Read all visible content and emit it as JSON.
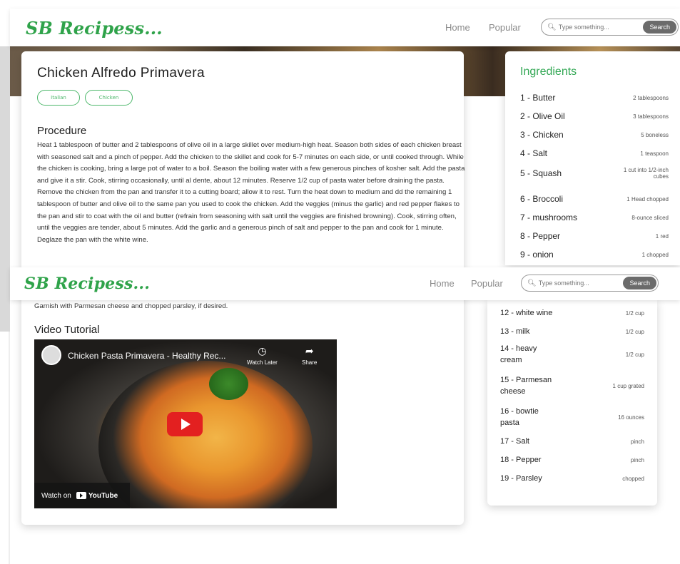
{
  "nav": {
    "logo": "SB Recipess...",
    "home": "Home",
    "popular": "Popular",
    "search_placeholder": "Type something...",
    "search_button": "Search"
  },
  "recipe": {
    "title": "Chicken Alfredo Primavera",
    "tags": [
      "Italian",
      "Chicken"
    ],
    "procedure_heading": "Procedure",
    "procedure_text": "Heat 1 tablespoon of butter and 2 tablespoons of olive oil in a large skillet over medium-high heat. Season both sides of each chicken breast with seasoned salt and a pinch of pepper. Add the chicken to the skillet and cook for 5-7 minutes on each side, or until cooked through. While the chicken is cooking, bring a large pot of water to a boil. Season the boiling water with a few generous pinches of kosher salt. Add the pasta and give it a stir. Cook, stirring occasionally, until al dente, about 12 minutes. Reserve 1/2 cup of pasta water before draining the pasta. Remove the chicken from the pan and transfer it to a cutting board; allow it to rest. Turn the heat down to medium and dd the remaining 1 tablespoon of butter and olive oil to the same pan you used to cook the chicken. Add the veggies (minus the garlic) and red pepper flakes to the pan and stir to coat with the oil and butter (refrain from seasoning with salt until the veggies are finished browning). Cook, stirring often, until the veggies are tender, about 5 minutes. Add the garlic and a generous pinch of salt and pepper to the pan and cook for 1 minute. Deglaze the pan with the white wine.",
    "garnish_text": "Garnish with Parmesan cheese and chopped parsley, if desired.",
    "video_heading": "Video Tutorial"
  },
  "video": {
    "title": "Chicken Pasta Primavera - Healthy Rec...",
    "watch_later": "Watch Later",
    "share": "Share",
    "watch_on": "Watch on",
    "youtube": "YouTube"
  },
  "ingredients": {
    "heading": "Ingredients",
    "items": [
      {
        "name": "1 - Butter",
        "qty": "2 tablespoons"
      },
      {
        "name": "2 - Olive Oil",
        "qty": "3 tablespoons"
      },
      {
        "name": "3 - Chicken",
        "qty": "5 boneless"
      },
      {
        "name": "4 - Salt",
        "qty": "1 teaspoon"
      },
      {
        "name": "5 - Squash",
        "qty": "1 cut into 1/2-inch cubes"
      },
      {
        "name": "6 - Broccoli",
        "qty": "1 Head chopped"
      },
      {
        "name": "7 - mushrooms",
        "qty": "8-ounce sliced"
      },
      {
        "name": "8 - Pepper",
        "qty": "1 red"
      },
      {
        "name": "9 - onion",
        "qty": "1 chopped"
      },
      {
        "name": "12 - white wine",
        "qty": "1/2 cup"
      },
      {
        "name": "13 - milk",
        "qty": "1/2 cup"
      },
      {
        "name": "14 - heavy cream",
        "qty": "1/2 cup"
      },
      {
        "name": "15 - Parmesan cheese",
        "qty": "1 cup grated"
      },
      {
        "name": "16 - bowtie pasta",
        "qty": "16 ounces"
      },
      {
        "name": "17 - Salt",
        "qty": "pinch"
      },
      {
        "name": "18 - Pepper",
        "qty": "pinch"
      },
      {
        "name": "19 - Parsley",
        "qty": "chopped"
      }
    ]
  }
}
